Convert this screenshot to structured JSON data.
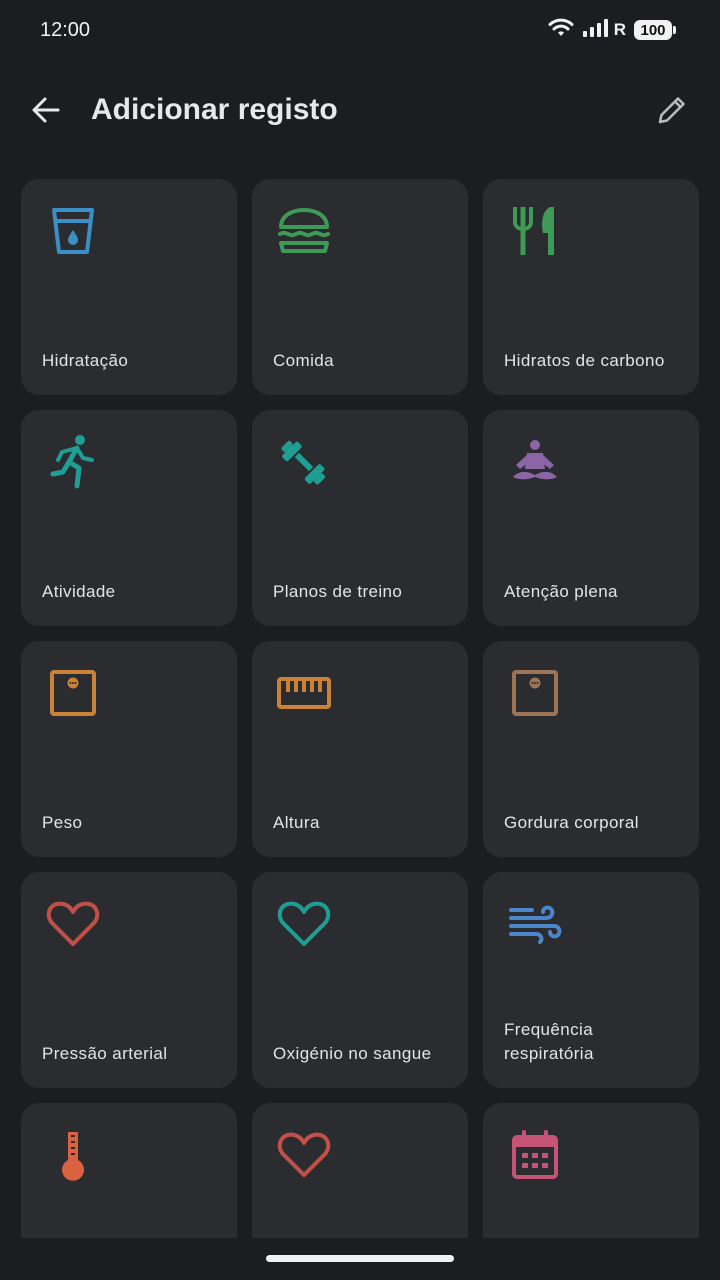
{
  "status": {
    "time": "12:00",
    "network_letter": "R",
    "battery": "100"
  },
  "header": {
    "title": "Adicionar registo"
  },
  "tiles": [
    {
      "label": "Hidratação",
      "icon": "glass-water-icon",
      "color": "#3a8fc4"
    },
    {
      "label": "Comida",
      "icon": "burger-icon",
      "color": "#3f9a57"
    },
    {
      "label": "Hidratos de carbono",
      "icon": "fork-knife-icon",
      "color": "#3f9a57"
    },
    {
      "label": "Atividade",
      "icon": "running-icon",
      "color": "#1f9e94"
    },
    {
      "label": "Planos de treino",
      "icon": "dumbbell-icon",
      "color": "#1f9e94"
    },
    {
      "label": "Atenção plena",
      "icon": "meditation-icon",
      "color": "#8a66a6"
    },
    {
      "label": "Peso",
      "icon": "scale-icon",
      "color": "#c98236"
    },
    {
      "label": "Altura",
      "icon": "ruler-icon",
      "color": "#c98236"
    },
    {
      "label": "Gordura corporal",
      "icon": "scale-icon",
      "color": "#9c7355"
    },
    {
      "label": "Pressão arterial",
      "icon": "heart-icon",
      "color": "#c2504a"
    },
    {
      "label": "Oxigénio no sangue",
      "icon": "heart-icon",
      "color": "#1f9e94"
    },
    {
      "label": "Frequência respiratória",
      "icon": "wind-icon",
      "color": "#4a86c9"
    },
    {
      "label": "",
      "icon": "thermometer-icon",
      "color": "#d96240"
    },
    {
      "label": "",
      "icon": "heart-icon",
      "color": "#c2504a"
    },
    {
      "label": "",
      "icon": "calendar-icon",
      "color": "#c55576"
    }
  ]
}
